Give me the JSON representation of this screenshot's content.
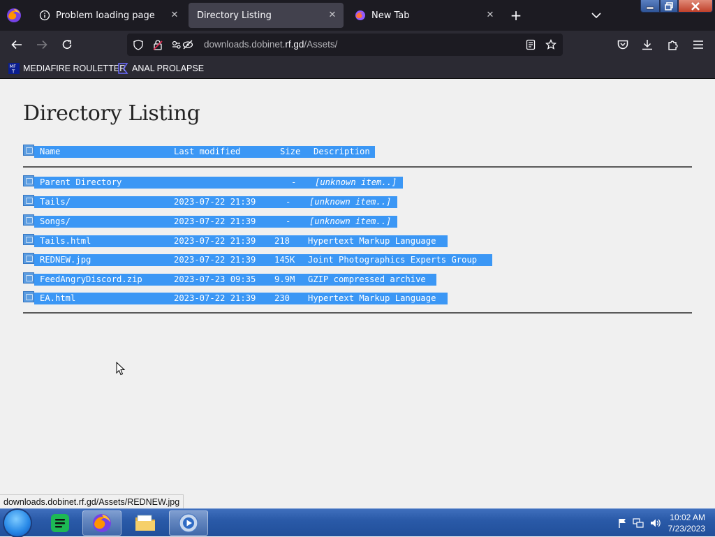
{
  "browser": {
    "tabs": [
      {
        "title": "Problem loading page",
        "icon": "info-icon",
        "close": "✕"
      },
      {
        "title": "Directory Listing",
        "icon": "none",
        "close": "✕"
      },
      {
        "title": "New Tab",
        "icon": "firefox-icon",
        "close": "✕"
      }
    ],
    "new_tab_label": "+",
    "url": {
      "host": "downloads.dobinet.rf.gd",
      "prefix": "downloads.dobinet.",
      "host_main": "rf.gd",
      "path": "/Assets/"
    },
    "bookmarks": [
      {
        "label": "MEDIAFIRE ROULETTER",
        "icon": "mft-icon"
      },
      {
        "label": "ANAL PROLAPSE",
        "icon": "bookmark-folder-icon"
      }
    ]
  },
  "page": {
    "title": "Directory Listing",
    "columns": {
      "name": "Name",
      "modified": "Last modified",
      "size": "Size",
      "description": "Description"
    },
    "rows": [
      {
        "name": "Parent Directory",
        "modified": "",
        "size": "-",
        "description": "[unknown item..]",
        "unknown": true
      },
      {
        "name": "Tails/",
        "modified": "2023-07-22 21:39",
        "size": "-",
        "description": "[unknown item..]",
        "unknown": true
      },
      {
        "name": "Songs/",
        "modified": "2023-07-22 21:39",
        "size": "-",
        "description": "[unknown item..]",
        "unknown": true
      },
      {
        "name": "Tails.html",
        "modified": "2023-07-22 21:39",
        "size": "218",
        "description": "Hypertext Markup Language"
      },
      {
        "name": "REDNEW.jpg",
        "modified": "2023-07-22 21:39",
        "size": "145K",
        "description": "Joint Photographics Experts Group"
      },
      {
        "name": "FeedAngryDiscord.zip",
        "modified": "2023-07-23 09:35",
        "size": "9.9M",
        "description": "GZIP compressed archive"
      },
      {
        "name": "EA.html",
        "modified": "2023-07-22 21:39",
        "size": "230",
        "description": "Hypertext Markup Language"
      }
    ]
  },
  "status_link": "downloads.dobinet.rf.gd/Assets/REDNEW.jpg",
  "taskbar": {
    "apps": [
      "spotify-icon",
      "firefox-icon",
      "file-explorer-icon",
      "media-player-icon"
    ],
    "clock_time": "10:02 AM",
    "clock_date": "7/23/2023"
  },
  "colors": {
    "selection": "#3b97f5",
    "tab_active": "#42414d",
    "chrome": "#2b2a33",
    "tabstrip": "#1c1b22",
    "taskbar": "#2a5aa8"
  }
}
